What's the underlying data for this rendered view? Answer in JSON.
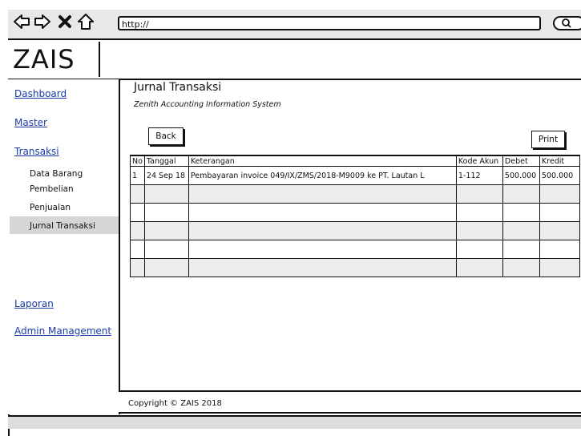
{
  "browser": {
    "url": "http://"
  },
  "header": {
    "logo": "ZAIS"
  },
  "sidebar": {
    "dashboard": "Dashboard",
    "master": "Master",
    "transaksi": "Transaksi",
    "sub_items": [
      "Data Barang",
      "Pembelian",
      "Penjualan",
      "Jurnal Transaksi"
    ],
    "laporan": "Laporan",
    "admin": "Admin Management"
  },
  "main": {
    "title": "Jurnal Transaksi",
    "subtitle": "Zenith Accounting Information System",
    "back_label": "Back",
    "print_label": "Print"
  },
  "table": {
    "columns": [
      "No",
      "Tanggal",
      "Keterangan",
      "Kode Akun",
      "Debet",
      "Kredit"
    ],
    "rows": [
      [
        "1",
        "24 Sep 18",
        "Pembayaran invoice 049/IX/ZMS/2018-M9009 ke PT. Lautan L",
        "1-112",
        "500.000",
        "500.000"
      ],
      [
        "",
        "",
        "",
        "",
        "",
        ""
      ],
      [
        "",
        "",
        "",
        "",
        "",
        ""
      ],
      [
        "",
        "",
        "",
        "",
        "",
        ""
      ],
      [
        "",
        "",
        "",
        "",
        "",
        ""
      ],
      [
        "",
        "",
        "",
        "",
        "",
        ""
      ]
    ]
  },
  "footer": {
    "copyright": "Copyright © ZAIS 2018"
  }
}
